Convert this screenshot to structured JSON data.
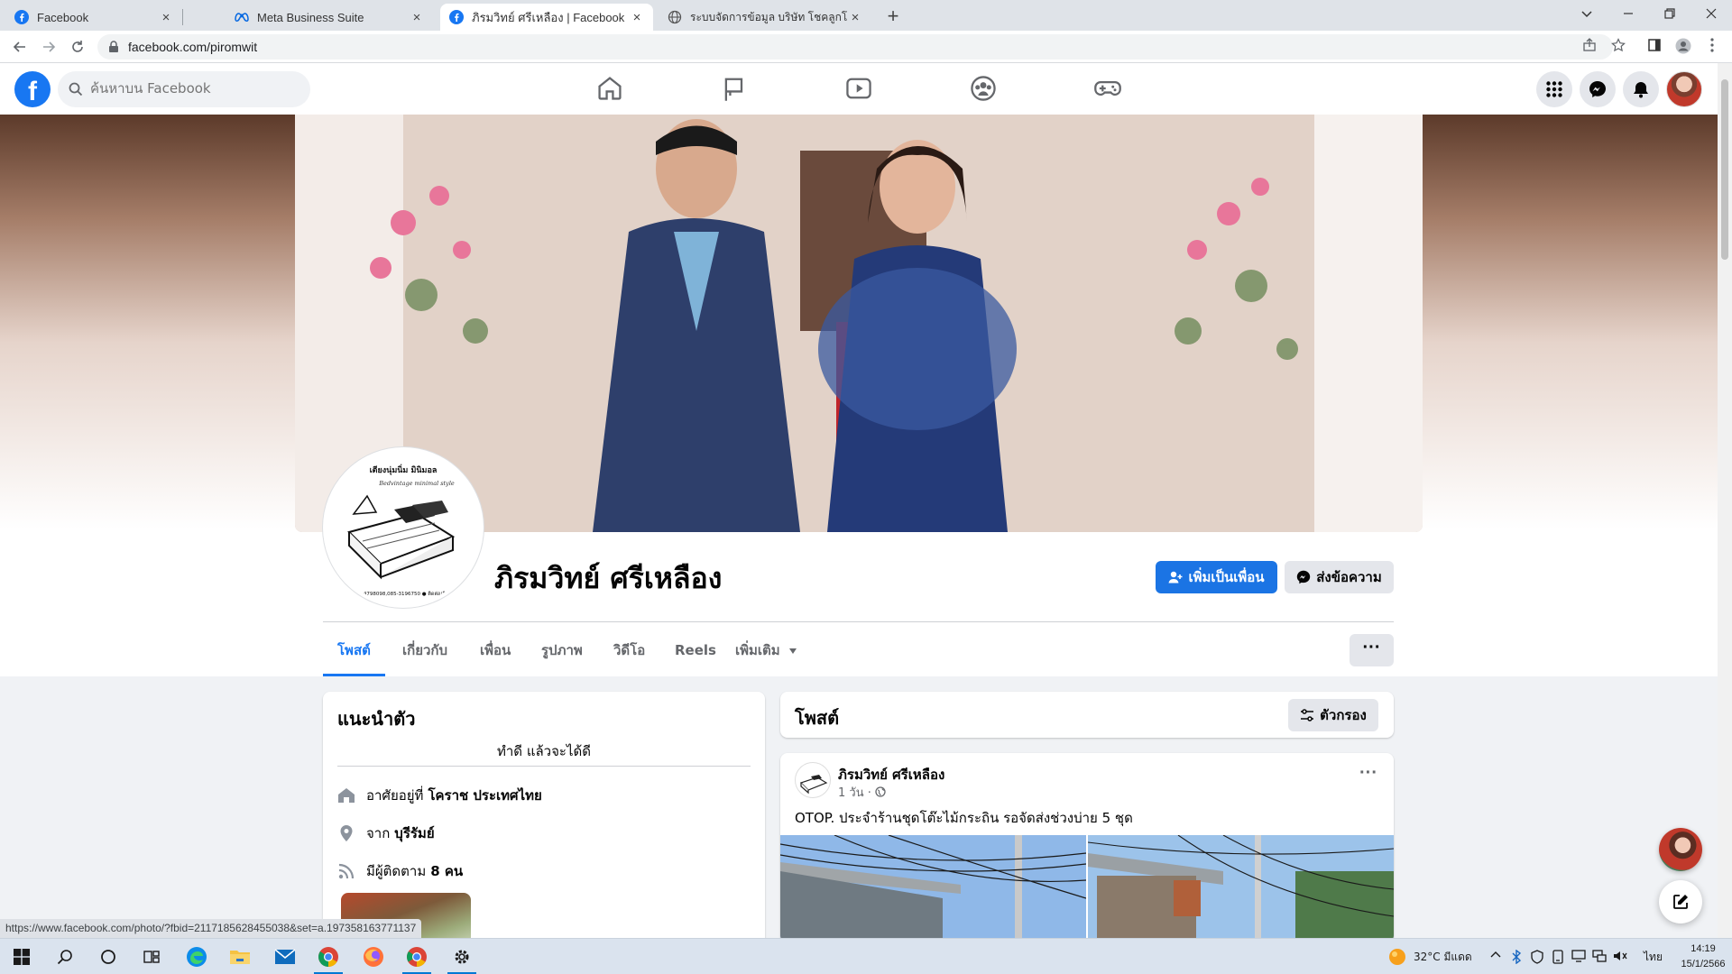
{
  "browser": {
    "tabs": [
      {
        "label": "Facebook",
        "icon": "facebook-icon",
        "active": false
      },
      {
        "label": "Meta Business Suite",
        "icon": "meta-icon",
        "active": false
      },
      {
        "label": "ภิรมวิทย์ ศรีเหลือง | Facebook",
        "icon": "facebook-icon",
        "active": true
      },
      {
        "label": "ระบบจัดการข้อมูล บริษัท โชคลูกโชค",
        "icon": "globe-icon",
        "active": false
      }
    ],
    "close_glyph": "×",
    "new_tab_glyph": "+",
    "url": "facebook.com/piromwit",
    "status_url": "https://www.facebook.com/photo/?fbid=2117185628455038&set=a.197358163771137"
  },
  "fb_nav": {
    "search_placeholder": "ค้นหาบน Facebook",
    "logo_letter": "f",
    "center_icons": [
      "home-icon",
      "pages-flag-icon",
      "watch-video-icon",
      "groups-icon",
      "gaming-icon"
    ],
    "right_icons": [
      "menu-grid-icon",
      "messenger-icon",
      "notifications-bell-icon",
      "account-avatar"
    ]
  },
  "profile": {
    "name": "ภิรมวิทย์ ศรีเหลือง",
    "add_friend_label": "เพิ่มเป็นเพื่อน",
    "message_label": "ส่งข้อความ",
    "more_glyph": "···",
    "pic_caption": "เตียงนุ่มนิ่ม มินิมอล",
    "pic_caption2": "Bedvintage minimal style",
    "pic_caption3": "080-4798098,085-3196750 ● ติดต่อ/ภิรมย์",
    "tabs": [
      {
        "label": "โพสต์",
        "active": true
      },
      {
        "label": "เกี่ยวกับ",
        "active": false
      },
      {
        "label": "เพื่อน",
        "active": false
      },
      {
        "label": "รูปภาพ",
        "active": false
      },
      {
        "label": "วิดีโอ",
        "active": false
      },
      {
        "label": "Reels",
        "active": false
      },
      {
        "label": "เพิ่มเติม",
        "active": false
      }
    ]
  },
  "intro": {
    "title": "แนะนำตัว",
    "bio": "ทำดี แล้วจะได้ดี",
    "lives_prefix": "อาศัยอยู่ที่",
    "lives_value": "โคราช ประเทศไทย",
    "from_prefix": "จาก",
    "from_value": "บุรีรัมย์",
    "followers_prefix": "มีผู้ติดตาม",
    "followers_value": "8 คน"
  },
  "posts": {
    "title": "โพสต์",
    "filter_label": "ตัวกรอง",
    "items": [
      {
        "author": "ภิรมวิทย์ ศรีเหลือง",
        "time": "1 วัน ·",
        "text": "OTOP. ประจำร้านชุดโต๊ะไม้กระถิน รอจัดส่งช่วงบ่าย 5 ชุด",
        "more_glyph": "···"
      }
    ]
  },
  "taskbar": {
    "pinned": [
      "windows-start-icon",
      "search-icon",
      "cortana-icon",
      "task-view-icon",
      "edge-icon",
      "file-explorer-icon",
      "mail-icon",
      "chrome-icon",
      "firefox-icon",
      "chrome-icon",
      "settings-gear-icon"
    ],
    "weather": "32°C มีแดด",
    "language": "ไทย",
    "time": "14:19",
    "date": "15/1/2566"
  },
  "colors": {
    "fb_blue": "#1877f2",
    "button_blue": "#1b74e4",
    "page_bg": "#f0f2f5",
    "secondary_text": "#65676b"
  }
}
